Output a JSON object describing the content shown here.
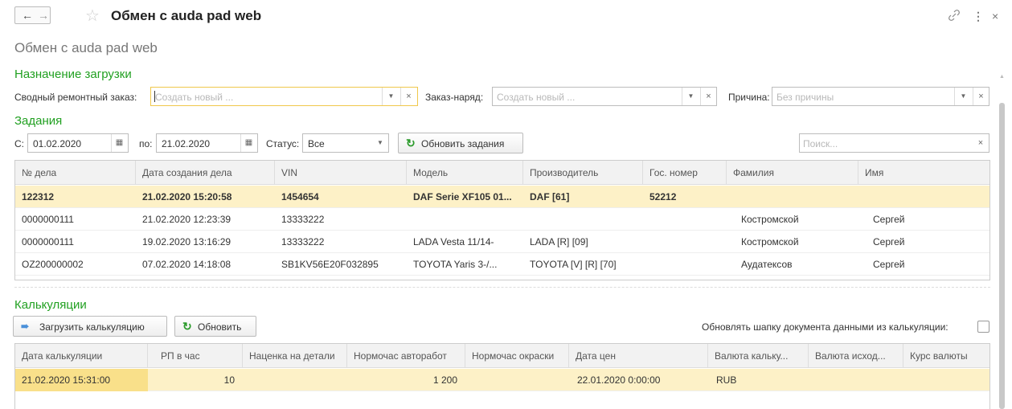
{
  "window": {
    "title": "Обмен с auda pad web",
    "back": "←",
    "forward": "→",
    "star": "☆",
    "link": "🔗",
    "more": "⋮",
    "close": "×"
  },
  "form_title": "Обмен с auda pad web",
  "assignment": {
    "section": "Назначение загрузки",
    "repair_order_label": "Сводный ремонтный заказ:",
    "repair_order_placeholder": "Создать новый ...",
    "work_order_label": "Заказ-наряд:",
    "work_order_placeholder": "Создать новый ...",
    "reason_label": "Причина:",
    "reason_placeholder": "Без причины"
  },
  "tasks": {
    "section": "Задания",
    "from_label": "С:",
    "from_value": "01.02.2020",
    "to_label": "по:",
    "to_value": "21.02.2020",
    "status_label": "Статус:",
    "status_value": "Все",
    "refresh_button": "Обновить задания",
    "search_placeholder": "Поиск...",
    "columns": [
      "№ дела",
      "Дата создания дела",
      "VIN",
      "Модель",
      "Производитель",
      "Гос. номер",
      "Фамилия",
      "Имя"
    ],
    "rows": [
      [
        "122312",
        "21.02.2020 15:20:58",
        "1454654",
        "DAF  Serie XF105 01...",
        "DAF [61]",
        "52212",
        "",
        ""
      ],
      [
        "0000000111",
        "21.02.2020 12:23:39",
        "13333222",
        "",
        "",
        "",
        "Костромской",
        "Сергей"
      ],
      [
        "0000000111",
        "19.02.2020 13:16:29",
        "13333222",
        "LADA  Vesta 11/14-",
        "LADA [R] [09]",
        "",
        "Костромской",
        "Сергей"
      ],
      [
        "OZ200000002",
        "07.02.2020 14:18:08",
        "SB1KV56E20F032895",
        "TOYOTA  Yaris 3-/...",
        "TOYOTA [V] [R] [70]",
        "",
        "Аудатексов",
        "Сергей"
      ]
    ]
  },
  "calculations": {
    "section": "Калькуляции",
    "load_button": "Загрузить калькуляцию",
    "refresh_button": "Обновить",
    "update_header_label": "Обновлять шапку документа данными из калькуляции:",
    "update_header_checked": false,
    "columns": [
      "Дата калькуляции",
      "РП в час",
      "Наценка на детали",
      "Нормочас авторабот",
      "Нормочас окраски",
      "Дата цен",
      "Валюта кальку...",
      "Валюта исход...",
      "Курс валюты"
    ],
    "rows": [
      [
        "21.02.2020 15:31:00",
        "10",
        "",
        "1 200",
        "",
        "22.01.2020 0:00:00",
        "RUB",
        "",
        ""
      ]
    ]
  },
  "colors": {
    "section_green": "#21a021",
    "selected_row": "#fdf1c7",
    "focus_border": "#f0c84b"
  }
}
